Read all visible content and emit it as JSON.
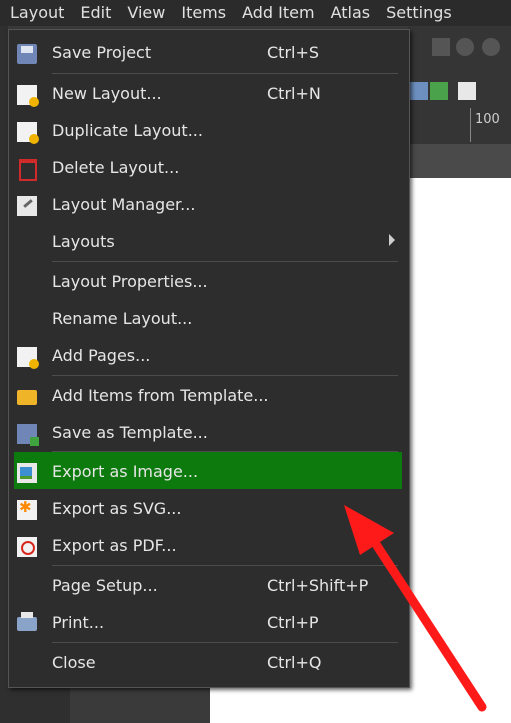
{
  "menubar": {
    "items": [
      {
        "label": "Layout",
        "first": true
      },
      {
        "label": "Edit"
      },
      {
        "label": "View"
      },
      {
        "label": "Items"
      },
      {
        "label": "Add Item"
      },
      {
        "label": "Atlas"
      },
      {
        "label": "Settings"
      }
    ]
  },
  "ruler": {
    "label": "100"
  },
  "menu": {
    "items": [
      {
        "label": "Save Project",
        "shortcut": "Ctrl+S",
        "icon": "save-icon"
      },
      {
        "label": "New Layout...",
        "shortcut": "Ctrl+N",
        "icon": "new-layout-icon"
      },
      {
        "label": "Duplicate Layout...",
        "shortcut": "",
        "icon": "duplicate-layout-icon"
      },
      {
        "label": "Delete Layout...",
        "shortcut": "",
        "icon": "trash-icon"
      },
      {
        "label": "Layout Manager...",
        "shortcut": "",
        "icon": "layout-manager-icon"
      },
      {
        "label": "Layouts",
        "shortcut": "",
        "icon": "",
        "submenu": true
      },
      {
        "label": "Layout Properties...",
        "shortcut": "",
        "icon": ""
      },
      {
        "label": "Rename Layout...",
        "shortcut": "",
        "icon": ""
      },
      {
        "label": "Add Pages...",
        "shortcut": "",
        "icon": "add-pages-icon"
      },
      {
        "label": "Add Items from Template...",
        "shortcut": "",
        "icon": "folder-icon"
      },
      {
        "label": "Save as Template...",
        "shortcut": "",
        "icon": "save-template-icon"
      },
      {
        "label": "Export as Image...",
        "shortcut": "",
        "icon": "export-image-icon",
        "highlighted": true
      },
      {
        "label": "Export as SVG...",
        "shortcut": "",
        "icon": "export-svg-icon"
      },
      {
        "label": "Export as PDF...",
        "shortcut": "",
        "icon": "export-pdf-icon"
      },
      {
        "label": "Page Setup...",
        "shortcut": "Ctrl+Shift+P",
        "icon": ""
      },
      {
        "label": "Print...",
        "shortcut": "Ctrl+P",
        "icon": "print-icon"
      },
      {
        "label": "Close",
        "shortcut": "Ctrl+Q",
        "icon": ""
      }
    ]
  },
  "colors": {
    "highlight": "#0d7a0d",
    "arrow": "#ff1a1a"
  }
}
